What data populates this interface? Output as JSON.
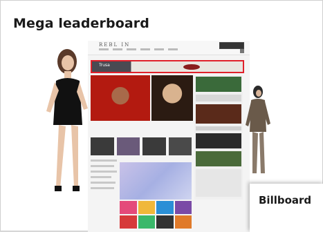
{
  "card": {
    "title": "Mega leaderboard"
  },
  "site": {
    "logo_text": "REBL IN"
  },
  "leaderboard_ad": {
    "brand": "Trusa",
    "highlight_color": "#e0202a"
  },
  "billboard_card": {
    "label": "Billboard"
  },
  "icons": [
    "model-left-figure",
    "model-right-figure",
    "lips-graphic"
  ]
}
